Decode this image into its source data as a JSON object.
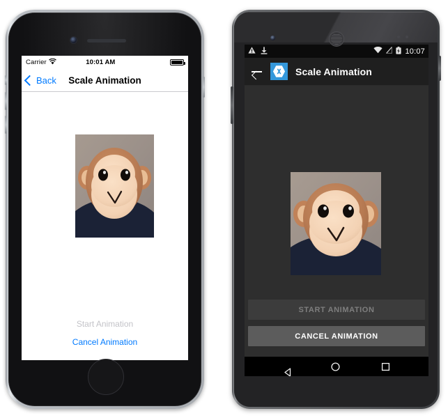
{
  "ios": {
    "device_name": "iPhone",
    "status_bar": {
      "carrier": "Carrier",
      "wifi_icon": "wifi-icon",
      "time": "10:01 AM",
      "battery_icon": "battery-full-icon"
    },
    "nav_bar": {
      "back_label": "Back",
      "back_icon": "chevron-left-icon",
      "title": "Scale Animation"
    },
    "content": {
      "image_name": "monkey-photo",
      "image_alt": "Plush monkey face photograph"
    },
    "buttons": {
      "start_label": "Start Animation",
      "start_state": "disabled",
      "cancel_label": "Cancel Animation",
      "cancel_state": "enabled"
    },
    "colors": {
      "tint": "#007aff",
      "disabled_text": "#c3c3c8",
      "screen_bg": "#ffffff"
    }
  },
  "android": {
    "device_name": "Android",
    "status_bar": {
      "warning_icon": "warning-triangle-icon",
      "download_icon": "download-icon",
      "wifi_icon": "wifi-icon",
      "signal_icon": "no-cellular-signal-icon",
      "battery_icon": "battery-charging-icon",
      "time": "10:07"
    },
    "app_bar": {
      "back_icon": "arrow-left-icon",
      "logo_icon": "xamarin-logo-icon",
      "title": "Scale Animation"
    },
    "content": {
      "image_name": "monkey-photo",
      "image_alt": "Plush monkey face photograph"
    },
    "buttons": {
      "start_label": "START ANIMATION",
      "start_state": "disabled",
      "cancel_label": "CANCEL ANIMATION",
      "cancel_state": "enabled"
    },
    "nav_bar": {
      "back_icon": "nav-back-triangle-icon",
      "home_icon": "nav-home-circle-icon",
      "recents_icon": "nav-recents-square-icon"
    },
    "colors": {
      "accent": "#3498db",
      "screen_bg": "#2e2e2e",
      "appbar_bg": "#1f1f1f",
      "button_enabled_bg": "#5c5c5c",
      "button_disabled_bg": "#3c3c3c"
    }
  }
}
